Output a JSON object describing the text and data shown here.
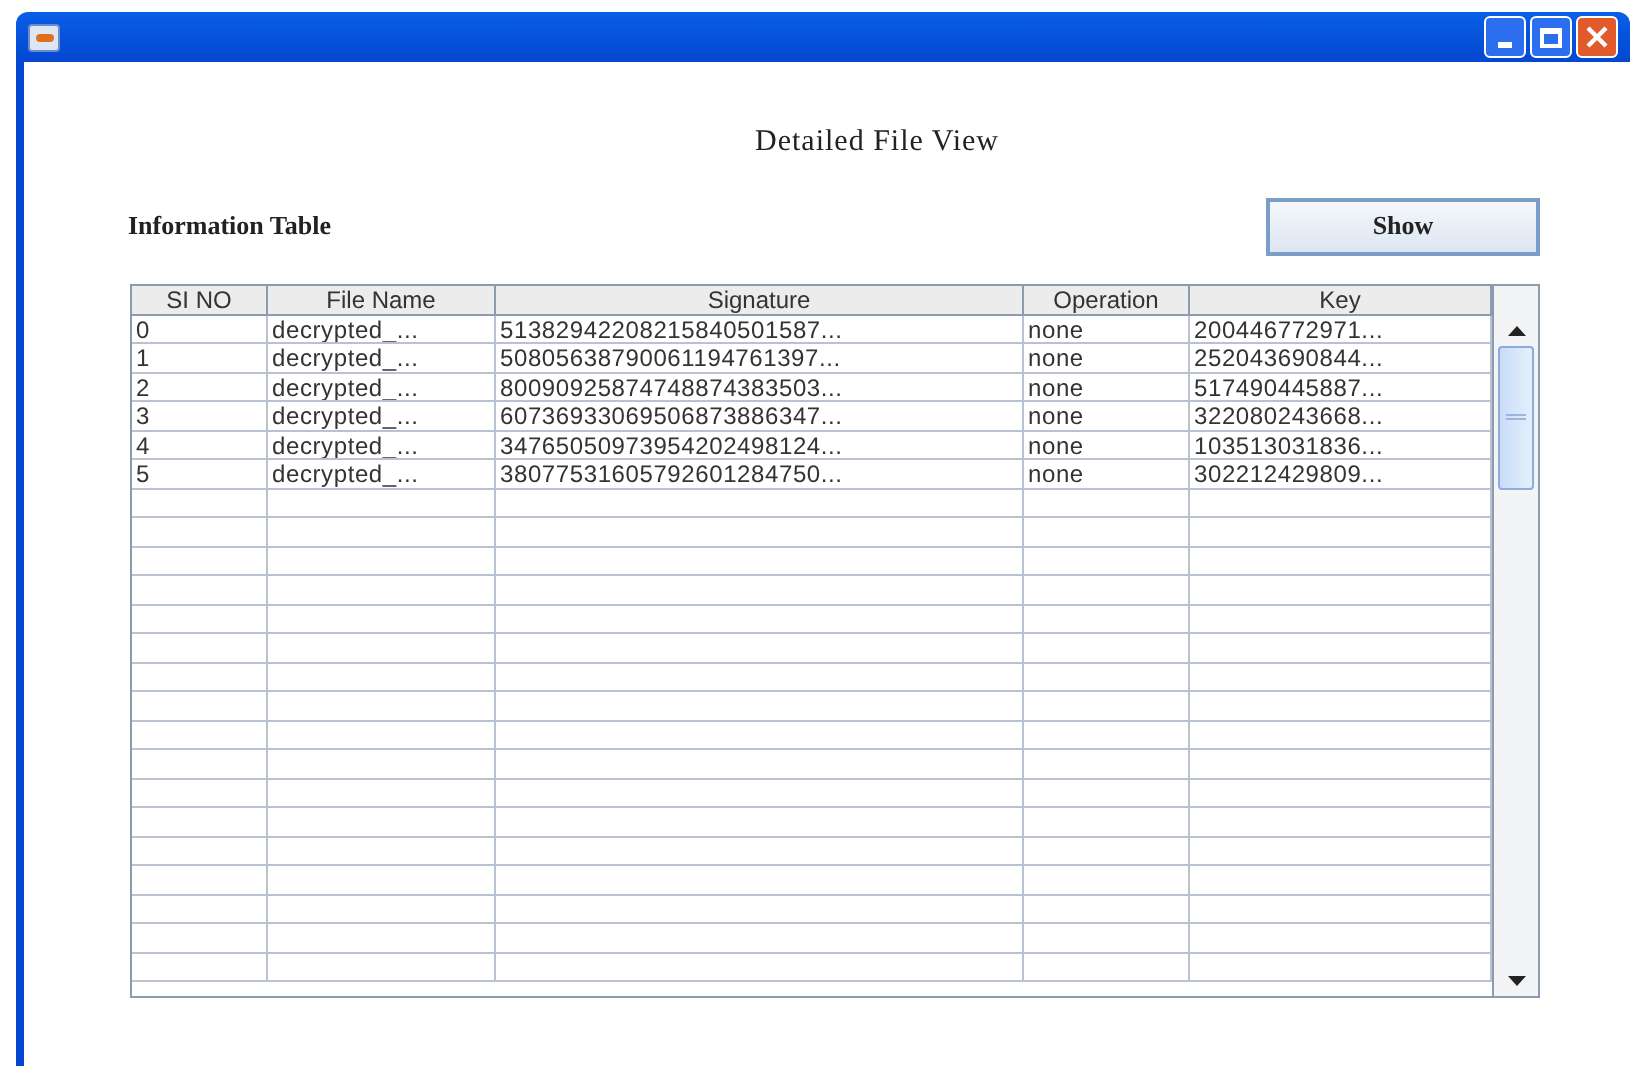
{
  "heading": "Detailed File View",
  "section_label": "Information Table",
  "show_button": "Show",
  "table": {
    "columns": [
      "SI NO",
      "File Name",
      "Signature",
      "Operation",
      "Key"
    ],
    "rows": [
      [
        "0",
        "decrypted_...",
        "51382942208215840501587...",
        "none",
        "200446772971..."
      ],
      [
        "1",
        "decrypted_...",
        "50805638790061194761397...",
        "none",
        "252043690844..."
      ],
      [
        "2",
        "decrypted_...",
        "80090925874748874383503...",
        "none",
        "517490445887..."
      ],
      [
        "3",
        "decrypted_...",
        "60736933069506873886347...",
        "none",
        "322080243668..."
      ],
      [
        "4",
        "decrypted_...",
        "34765050973954202498124...",
        "none",
        "103513031836..."
      ],
      [
        "5",
        "decrypted_...",
        "38077531605792601284750...",
        "none",
        "302212429809..."
      ]
    ]
  }
}
